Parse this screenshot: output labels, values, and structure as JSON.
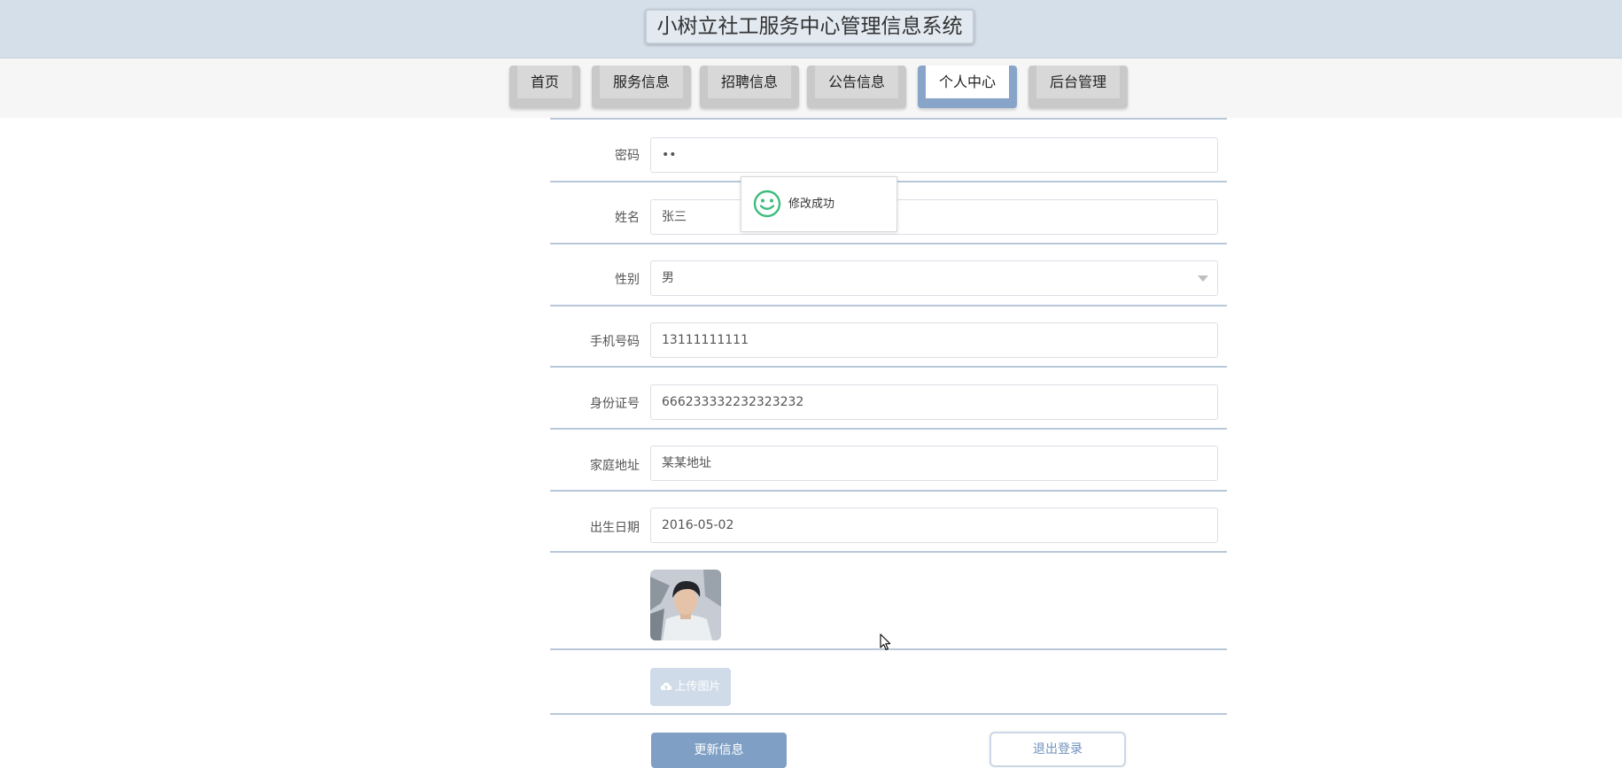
{
  "header": {
    "title": "小树立社工服务中心管理信息系统"
  },
  "nav": {
    "items": [
      {
        "label": "首页"
      },
      {
        "label": "服务信息"
      },
      {
        "label": "招聘信息"
      },
      {
        "label": "公告信息"
      },
      {
        "label": "个人中心",
        "active": true
      },
      {
        "label": "后台管理"
      }
    ]
  },
  "form": {
    "password": {
      "label": "密码",
      "value": "••"
    },
    "name": {
      "label": "姓名",
      "value": "张三"
    },
    "gender": {
      "label": "性别",
      "value": "男"
    },
    "phone": {
      "label": "手机号码",
      "value": "13111111111"
    },
    "id_card": {
      "label": "身份证号",
      "value": "666233332232323232"
    },
    "address": {
      "label": "家庭地址",
      "value": "某某地址"
    },
    "birthday": {
      "label": "出生日期",
      "value": "2016-05-02"
    },
    "upload_label": "上传图片"
  },
  "actions": {
    "update_label": "更新信息",
    "logout_label": "退出登录"
  },
  "toast": {
    "message": "修改成功",
    "icon": "smile-icon"
  },
  "colors": {
    "header_bg": "#d5dfe9",
    "nav_active": "#88a4c8",
    "primary_button": "#7f9fc4",
    "toast_icon": "#3dbd7d"
  }
}
